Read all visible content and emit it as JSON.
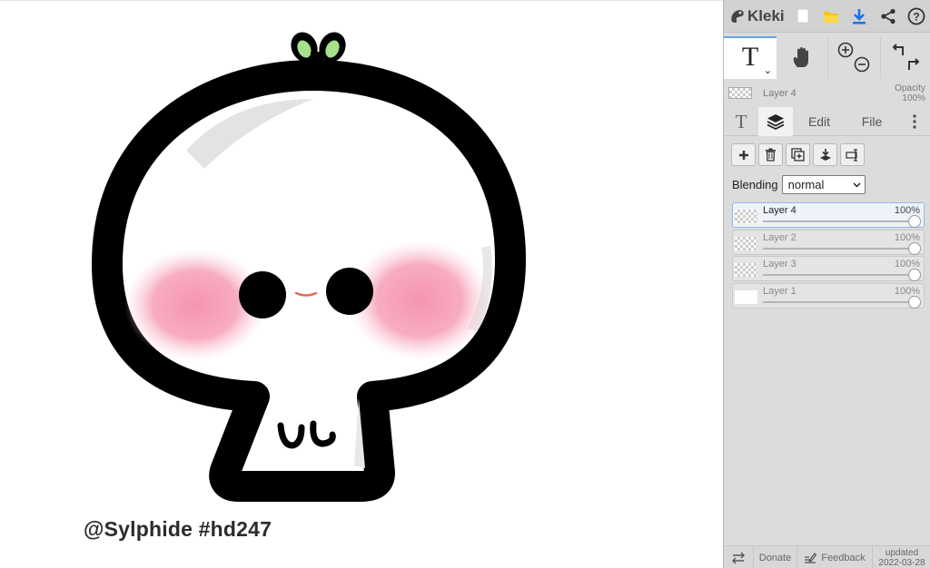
{
  "app": {
    "name": "Kleki",
    "accent": "#1a73e8"
  },
  "canvas": {
    "watermark": "@Sylphide #hd247",
    "colors": {
      "outline": "#000000",
      "blush": "#f6a0b6",
      "sprout": "#a6e08a",
      "mouth": "#e5675a",
      "shine": "#e6e6e6"
    }
  },
  "toolbar": {
    "icons": [
      "new-file-icon",
      "open-folder-icon",
      "download-icon",
      "share-icon",
      "help-icon"
    ]
  },
  "tools": {
    "text_tool_glyph": "T",
    "caret": "⌄",
    "icons": [
      "text-tool-icon",
      "hand-tool-icon",
      "zoom-in-icon",
      "zoom-out-icon",
      "undo-icon",
      "redo-icon"
    ]
  },
  "layer_info": {
    "name": "Layer 4",
    "opacity_label": "Opacity",
    "opacity_value": "100%"
  },
  "tabs": {
    "text_glyph": "T",
    "edit": "Edit",
    "file": "File"
  },
  "layer_actions": [
    "add-layer-icon",
    "delete-layer-icon",
    "duplicate-layer-icon",
    "merge-down-icon",
    "rename-layer-icon"
  ],
  "blending": {
    "label": "Blending",
    "value": "normal"
  },
  "layers": [
    {
      "name": "Layer 4",
      "opacity": "100%",
      "selected": true
    },
    {
      "name": "Layer 2",
      "opacity": "100%",
      "selected": false
    },
    {
      "name": "Layer 3",
      "opacity": "100%",
      "selected": false
    },
    {
      "name": "Layer 1",
      "opacity": "100%",
      "selected": false
    }
  ],
  "bottom": {
    "donate": "Donate",
    "feedback": "Feedback",
    "updated_label": "updated",
    "updated_date": "2022-03-28"
  }
}
